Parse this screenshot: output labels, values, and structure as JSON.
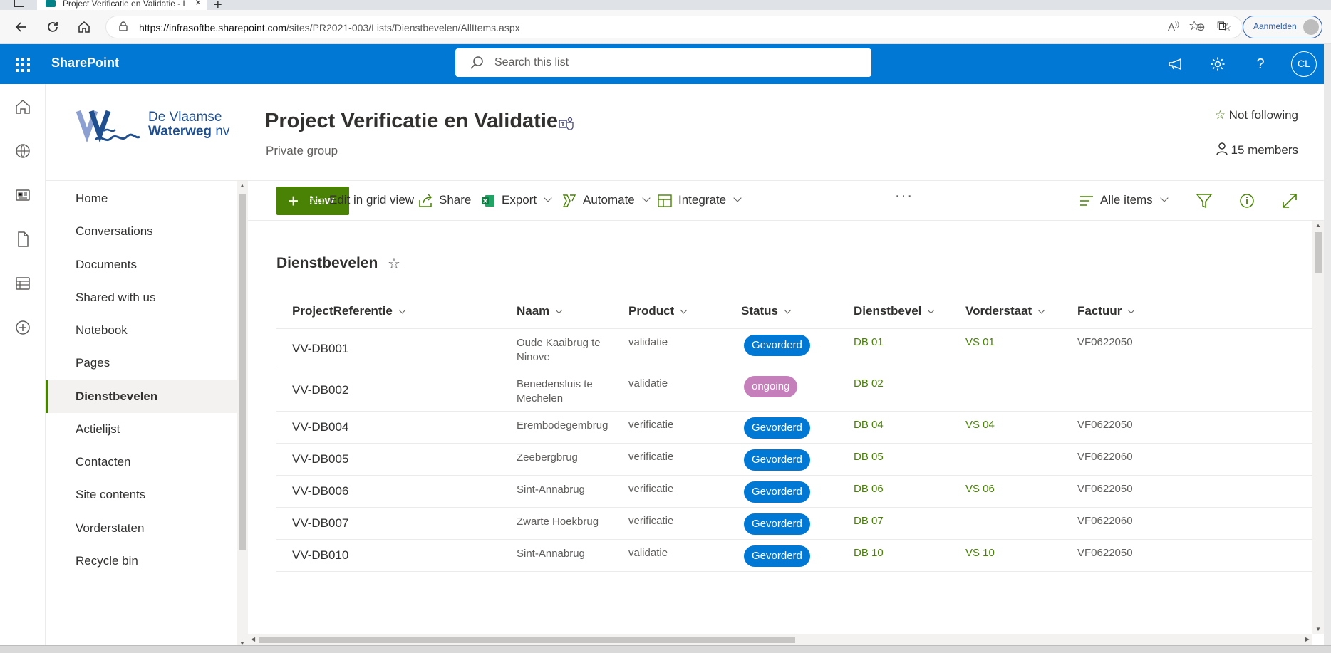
{
  "browser": {
    "tab_title": "Project Verificatie en Validatie - L",
    "url_domain": "https://infrasoftbe.sharepoint.com",
    "url_path": "/sites/PR2021-003/Lists/Dienstbevelen/AllItems.aspx",
    "signin_label": "Aanmelden"
  },
  "suite": {
    "brand": "SharePoint",
    "search_placeholder": "Search this list",
    "user_initials": "CL",
    "accent_color": "#0078d4"
  },
  "site": {
    "logo_line1": "De Vlaamse",
    "logo_line2": "Waterweg",
    "logo_line2_suffix": "nv",
    "title": "Project Verificatie en Validatie",
    "subtitle": "Private group",
    "follow_label": "Not following",
    "members_label": "15 members"
  },
  "leftnav": {
    "items": [
      {
        "label": "Home"
      },
      {
        "label": "Conversations"
      },
      {
        "label": "Documents"
      },
      {
        "label": "Shared with us"
      },
      {
        "label": "Notebook"
      },
      {
        "label": "Pages"
      },
      {
        "label": "Dienstbevelen",
        "selected": true
      },
      {
        "label": "Actielijst"
      },
      {
        "label": "Contacten"
      },
      {
        "label": "Site contents"
      },
      {
        "label": "Vorderstaten"
      },
      {
        "label": "Recycle bin"
      }
    ]
  },
  "command_bar": {
    "new_label": "New",
    "edit_grid_label": "Edit in grid view",
    "share_label": "Share",
    "export_label": "Export",
    "automate_label": "Automate",
    "integrate_label": "Integrate",
    "more_label": "···",
    "view_label": "Alle items",
    "new_color": "#498205"
  },
  "list": {
    "title": "Dienstbevelen",
    "columns": [
      "ProjectReferentie",
      "Naam",
      "Product",
      "Status",
      "Dienstbevel",
      "Vorderstaat",
      "Factuur"
    ],
    "rows": [
      {
        "ref": "VV-DB001",
        "naam": "Oude Kaaibrug te Ninove",
        "product": "validatie",
        "status": "Gevorderd",
        "dienstbevel": "DB 01",
        "vorderstaat": "VS 01",
        "factuur": "VF0622050"
      },
      {
        "ref": "VV-DB002",
        "naam": "Benedensluis te Mechelen",
        "product": "validatie",
        "status": "ongoing",
        "dienstbevel": "DB 02",
        "vorderstaat": "",
        "factuur": ""
      },
      {
        "ref": "VV-DB004",
        "naam": "Erembodegembrug",
        "product": "verificatie",
        "status": "Gevorderd",
        "dienstbevel": "DB 04",
        "vorderstaat": "VS 04",
        "factuur": "VF0622050"
      },
      {
        "ref": "VV-DB005",
        "naam": "Zeebergbrug",
        "product": "verificatie",
        "status": "Gevorderd",
        "dienstbevel": "DB 05",
        "vorderstaat": "",
        "factuur": "VF0622060"
      },
      {
        "ref": "VV-DB006",
        "naam": "Sint-Annabrug",
        "product": "verificatie",
        "status": "Gevorderd",
        "dienstbevel": "DB 06",
        "vorderstaat": "VS 06",
        "factuur": "VF0622050"
      },
      {
        "ref": "VV-DB007",
        "naam": "Zwarte Hoekbrug",
        "product": "verificatie",
        "status": "Gevorderd",
        "dienstbevel": "DB 07",
        "vorderstaat": "",
        "factuur": "VF0622060"
      },
      {
        "ref": "VV-DB010",
        "naam": "Sint-Annabrug",
        "product": "validatie",
        "status": "Gevorderd",
        "dienstbevel": "DB 10",
        "vorderstaat": "VS 10",
        "factuur": "VF0622050"
      }
    ],
    "status_colors": {
      "Gevorderd": "#0078d4",
      "ongoing": "#c57fba"
    },
    "link_color": "#498205"
  }
}
